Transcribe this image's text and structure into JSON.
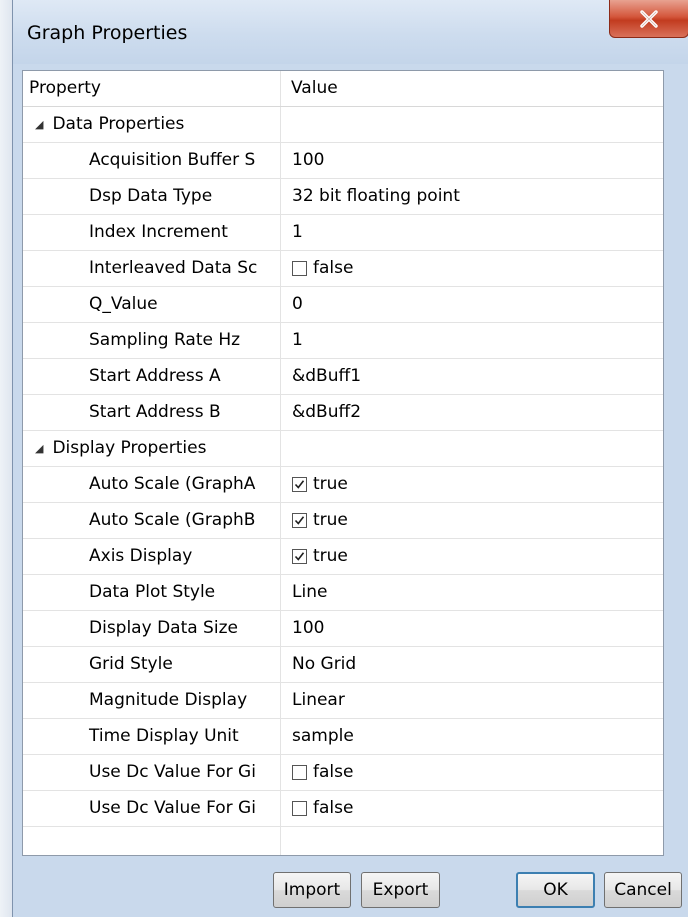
{
  "window": {
    "title": "Graph Properties"
  },
  "grid": {
    "columns": {
      "property": "Property",
      "value": "Value"
    },
    "categories": [
      {
        "label": "Data Properties",
        "items": [
          {
            "name": "Acquisition Buffer S",
            "value": "100"
          },
          {
            "name": "Dsp Data Type",
            "value": "32 bit floating point"
          },
          {
            "name": "Index Increment",
            "value": "1"
          },
          {
            "name": "Interleaved Data Sc",
            "value": "false",
            "checkbox": true,
            "checked": false
          },
          {
            "name": "Q_Value",
            "value": "0"
          },
          {
            "name": "Sampling Rate Hz",
            "value": "1"
          },
          {
            "name": "Start Address A",
            "value": "&dBuff1"
          },
          {
            "name": "Start Address B",
            "value": "&dBuff2"
          }
        ]
      },
      {
        "label": "Display Properties",
        "items": [
          {
            "name": "Auto Scale (GraphA",
            "value": "true",
            "checkbox": true,
            "checked": true
          },
          {
            "name": "Auto Scale (GraphB",
            "value": "true",
            "checkbox": true,
            "checked": true
          },
          {
            "name": "Axis Display",
            "value": "true",
            "checkbox": true,
            "checked": true
          },
          {
            "name": "Data Plot Style",
            "value": "Line"
          },
          {
            "name": "Display Data Size",
            "value": "100"
          },
          {
            "name": "Grid Style",
            "value": "No Grid"
          },
          {
            "name": "Magnitude Display",
            "value": "Linear"
          },
          {
            "name": "Time Display Unit",
            "value": "sample"
          },
          {
            "name": "Use Dc Value For Gi",
            "value": "false",
            "checkbox": true,
            "checked": false
          },
          {
            "name": "Use Dc Value For Gi",
            "value": "false",
            "checkbox": true,
            "checked": false
          }
        ]
      }
    ]
  },
  "buttons": {
    "import": "Import",
    "export": "Export",
    "ok": "OK",
    "cancel": "Cancel"
  },
  "colors": {
    "frame": "#c9d9ec",
    "close": "#c23b1f",
    "default_button_border": "#3c7fb1"
  }
}
